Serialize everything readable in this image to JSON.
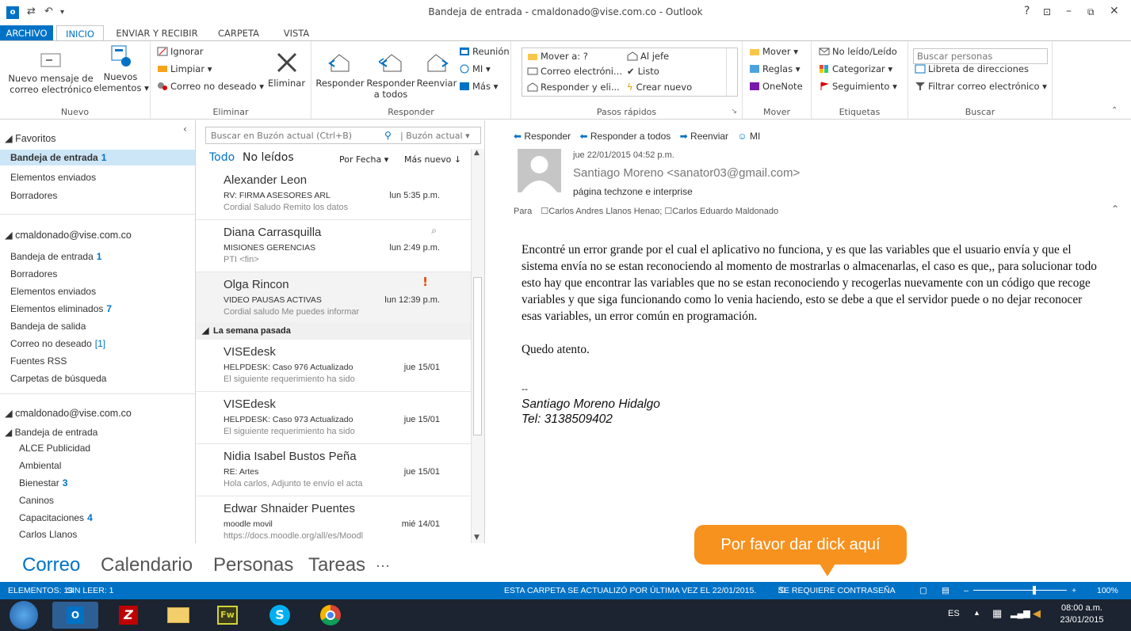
{
  "window": {
    "title": "Bandeja de entrada - cmaldonado@vise.com.co - Outlook",
    "help": "?"
  },
  "tabs": [
    {
      "label": "ARCHIVO"
    },
    {
      "label": "INICIO"
    },
    {
      "label": "ENVIAR Y RECIBIR"
    },
    {
      "label": "CARPETA"
    },
    {
      "label": "VISTA"
    }
  ],
  "ribbon": {
    "nuevo": {
      "new_mail_line1": "Nuevo mensaje de",
      "new_mail_line2": "correo electrónico",
      "new_items_line1": "Nuevos",
      "new_items_line2": "elementos",
      "label": "Nuevo"
    },
    "eliminar": {
      "ignore": "Ignorar",
      "clean": "Limpiar",
      "junk": "Correo no deseado",
      "delete": "Eliminar",
      "label": "Eliminar"
    },
    "responder": {
      "reply": "Responder",
      "reply_all_line1": "Responder",
      "reply_all_line2": "a todos",
      "forward": "Reenviar",
      "meeting": "Reunión",
      "im": "MI",
      "more": "Más",
      "label": "Responder"
    },
    "quick_steps": {
      "move_to": "Mover a: ?",
      "to_boss": "Al jefe",
      "email": "Correo electróni...",
      "done": "Listo",
      "reply_delete": "Responder y eli...",
      "create_new": "Crear nuevo",
      "label": "Pasos rápidos"
    },
    "mover": {
      "move": "Mover",
      "rules": "Reglas",
      "onenote": "OneNote",
      "label": "Mover"
    },
    "etiquetas": {
      "unread_read": "No leído/Leído",
      "categorize": "Categorizar",
      "follow_up": "Seguimiento",
      "label": "Etiquetas"
    },
    "buscar": {
      "search_people_placeholder": "Buscar personas",
      "address_book": "Libreta de direcciones",
      "filter_email": "Filtrar correo electrónico",
      "label": "Buscar"
    }
  },
  "nav": {
    "favorites_header": "Favoritos",
    "favorites": [
      {
        "label": "Bandeja de entrada",
        "count": "1"
      },
      {
        "label": "Elementos enviados",
        "count": ""
      },
      {
        "label": "Borradores",
        "count": ""
      }
    ],
    "account1_header": "cmaldonado@vise.com.co",
    "account1": [
      {
        "label": "Bandeja de entrada",
        "count": "1"
      },
      {
        "label": "Borradores",
        "count": ""
      },
      {
        "label": "Elementos enviados",
        "count": ""
      },
      {
        "label": "Elementos eliminados",
        "count": "7"
      },
      {
        "label": "Bandeja de salida",
        "count": ""
      },
      {
        "label": "Correo no deseado",
        "count": "[1]"
      },
      {
        "label": "Fuentes RSS",
        "count": ""
      },
      {
        "label": "Carpetas de búsqueda",
        "count": ""
      }
    ],
    "account2_header": "cmaldonado@vise.com.co",
    "inbox_header": "Bandeja de entrada",
    "subfolders": [
      {
        "label": "ALCE Publicidad",
        "count": ""
      },
      {
        "label": "Ambiental",
        "count": ""
      },
      {
        "label": "Bienestar",
        "count": "3"
      },
      {
        "label": "Caninos",
        "count": ""
      },
      {
        "label": "Capacitaciones",
        "count": "4"
      },
      {
        "label": "Carlos Llanos",
        "count": ""
      }
    ]
  },
  "list": {
    "search_placeholder": "Buscar en Buzón actual (Ctrl+B)",
    "scope": "Buzón actual",
    "filter_all": "Todo",
    "filter_unread": "No leídos",
    "sort_by": "Por Fecha",
    "order": "Más nuevo",
    "group_last_week": "La semana pasada",
    "messages": [
      {
        "from": "Alexander Leon",
        "subject": "RV: FIRMA ASESORES ARL",
        "time": "lun 5:35 p.m.",
        "preview": "Cordial Saludo  Remito los datos"
      },
      {
        "from": "Diana Carrasquilla",
        "subject": "MISIONES GERENCIAS",
        "time": "lun 2:49 p.m.",
        "preview": "PTI <fin>"
      },
      {
        "from": "Olga Rincon",
        "subject": "VIDEO PAUSAS ACTIVAS",
        "time": "lun 12:39 p.m.",
        "preview": "Cordial saludo  Me puedes informar"
      },
      {
        "from": "VISEdesk",
        "subject": "HELPDESK: Caso 976 Actualizado",
        "time": "jue 15/01",
        "preview": "El siguiente requerimiento ha sido"
      },
      {
        "from": "VISEdesk",
        "subject": "HELPDESK: Caso 973 Actualizado",
        "time": "jue 15/01",
        "preview": "El siguiente requerimiento ha sido"
      },
      {
        "from": "Nidia Isabel Bustos Peña",
        "subject": "RE: Artes",
        "time": "jue 15/01",
        "preview": "Hola carlos,  Adjunto te envío el acta"
      },
      {
        "from": "Edwar Shnaider Puentes",
        "subject": "moodle movil",
        "time": "mié 14/01",
        "preview": "https://docs.moodle.org/all/es/Moodl"
      }
    ]
  },
  "reading": {
    "actions": {
      "reply": "Responder",
      "reply_all": "Responder a todos",
      "forward": "Reenviar",
      "im": "MI"
    },
    "date": "jue 22/01/2015 04:52 p.m.",
    "sender": "Santiago Moreno <sanator03@gmail.com>",
    "subject": "página techzone e interprise",
    "to_label": "Para",
    "recipient1": "Carlos Andres Llanos Henao;",
    "recipient2": "Carlos Eduardo Maldonado",
    "body": "Encontré un error grande por el cual el aplicativo no funciona, y es que las variables que el usuario envía y que el sistema envía no se estan reconociendo al momento de mostrarlas o almacenarlas, el caso es que,, para solucionar todo esto hay que encontrar las variables que no se estan reconociendo y recogerlas nuevamente con un código que recoge variables y que siga funcionando como lo venia haciendo, esto se debe a que el servidor puede o no dejar reconocer esas variables, un error común en programación.",
    "closing": "Quedo atento.",
    "sig_dash": "--",
    "sig_name": "Santiago Moreno Hidalgo",
    "sig_tel": "Tel: 3138509402"
  },
  "bottom_nav": {
    "mail": "Correo",
    "calendar": "Calendario",
    "people": "Personas",
    "tasks": "Tareas",
    "more": "···"
  },
  "tooltip": "Por favor dar dick aquí",
  "status": {
    "items": "ELEMENTOS: 13",
    "unread": "SIN LEER: 1",
    "updated": "ESTA CARPETA SE ACTUALIZÓ POR ÚLTIMA VEZ EL 22/01/2015.",
    "password": "SE REQUIERE CONTRASEÑA",
    "zoom": "100%"
  },
  "taskbar": {
    "lang": "ES",
    "time": "08:00 a.m.",
    "date": "23/01/2015"
  },
  "colors": {
    "accent": "#0072c6",
    "tooltip": "#f7921e",
    "taskbar": "#1b2430",
    "selected": "#cde6f7"
  }
}
